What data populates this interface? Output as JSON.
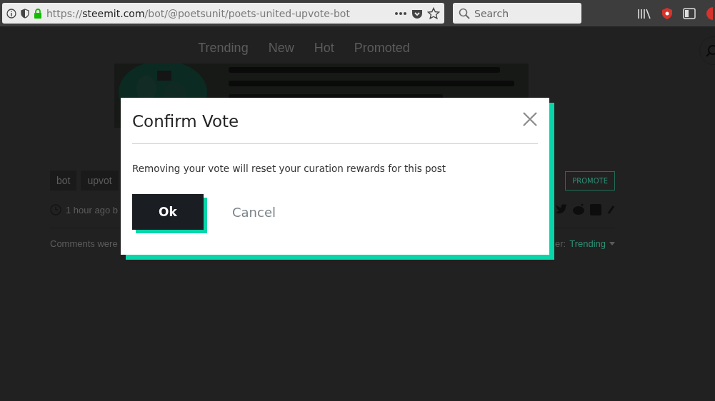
{
  "browser": {
    "url": {
      "scheme": "https://",
      "host": "steemit.com",
      "path": "/bot/@poetsunit/poets-united-upvote-bot"
    },
    "search": {
      "placeholder": "Search"
    }
  },
  "page": {
    "nav": [
      "Trending",
      "New",
      "Hot",
      "Promoted"
    ],
    "tags": [
      "bot",
      "upvot"
    ],
    "promote_button": "PROMOTE",
    "meta": "1 hour ago b",
    "comments_text": "Comments were",
    "sort_label": "er:",
    "sort_value": "Trending"
  },
  "dialog": {
    "title": "Confirm Vote",
    "message": "Removing your vote will reset your curation rewards for this post",
    "buttons": [
      {
        "label": "Ok",
        "kind": "primary"
      },
      {
        "label": "Cancel",
        "kind": "secondary"
      }
    ]
  }
}
